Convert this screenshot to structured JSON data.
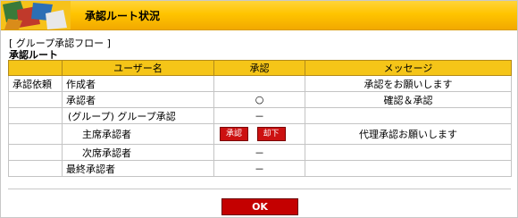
{
  "header": {
    "title": "承認ルート状況"
  },
  "flow_label": "[ グループ承認フロー ]",
  "route_label": "承認ルート",
  "table": {
    "headers": [
      "",
      "ユーザー名",
      "承認",
      "メッセージ"
    ],
    "rows": [
      {
        "type": "承認依頼",
        "user": "作成者",
        "approval": "",
        "message": "承認をお願いします"
      },
      {
        "type": "",
        "user": "承認者",
        "approval": "○",
        "message": "確認＆承認"
      },
      {
        "type": "",
        "user": "(グループ) グループ承認",
        "approval": "－",
        "message": ""
      },
      {
        "type": "",
        "user": "主席承認者",
        "approve_button": "承認",
        "reject_button": "却下",
        "message": "代理承認お願いします"
      },
      {
        "type": "",
        "user": "次席承認者",
        "approval": "－",
        "message": ""
      },
      {
        "type": "",
        "user": "最終承認者",
        "approval": "－",
        "message": ""
      }
    ]
  },
  "ok_label": "OK"
}
